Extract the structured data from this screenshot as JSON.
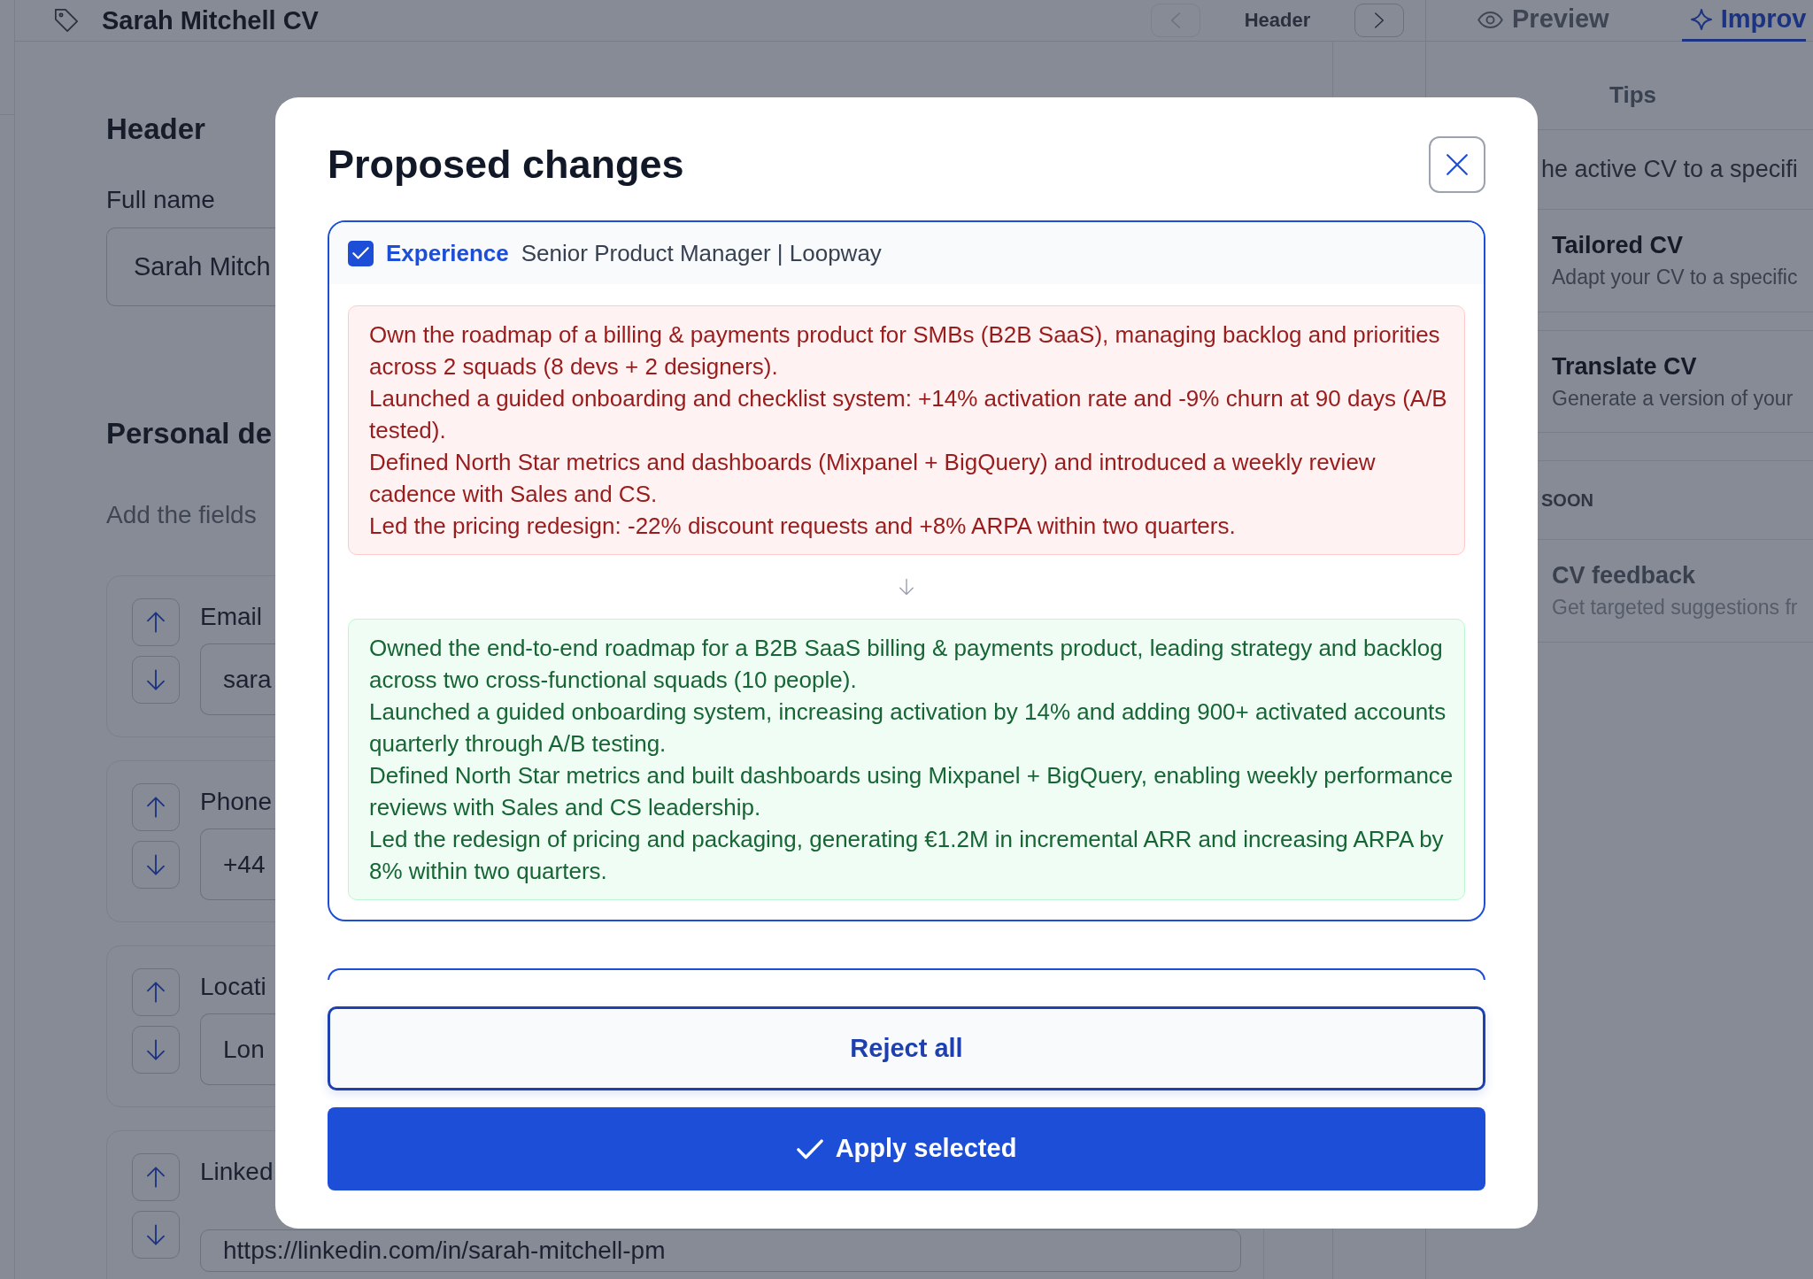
{
  "top_bar": {
    "title": "Sarah Mitchell CV",
    "section_nav": {
      "label": "Header",
      "prev": {
        "disabled": true
      },
      "next": {
        "disabled": false
      }
    }
  },
  "editor": {
    "header_section": {
      "title": "Header",
      "fields": [
        {
          "label": "Full name",
          "value": "Sarah Mitch"
        }
      ]
    },
    "personal_details": {
      "title": "Personal de",
      "hint": "Add the fields",
      "fields": [
        {
          "label": "Email",
          "value": "sara"
        },
        {
          "label": "Phone",
          "value": "+44"
        },
        {
          "label": "Locati",
          "value": "Lon"
        },
        {
          "label": "Linked",
          "value": "https://linkedin.com/in/sarah-mitchell-pm"
        }
      ]
    }
  },
  "side_panel": {
    "tabs": [
      {
        "label": "Preview",
        "selected": false
      },
      {
        "label": "Improv",
        "selected": true
      }
    ],
    "section_title": "Tips",
    "intro": "he active CV to a specifi",
    "tools": [
      {
        "title": "Tailored CV",
        "description": "Adapt your CV to a specific",
        "disabled": false
      },
      {
        "title": "Translate CV",
        "description": "Generate a version of your",
        "disabled": false
      }
    ],
    "soon_group": {
      "label": "SOON",
      "tools": [
        {
          "title": "CV feedback",
          "description": "Get targeted suggestions fr",
          "disabled": true
        }
      ]
    }
  },
  "dialog": {
    "title": "Proposed changes",
    "changes": [
      {
        "checked": true,
        "section": "Experience",
        "subtitle": "Senior Product Manager | Loopway",
        "before": [
          "Own the roadmap of a billing & payments product for SMBs (B2B SaaS), managing backlog and priorities across 2 squads (8 devs + 2 designers).",
          "Launched a guided onboarding and checklist system: +14% activation rate and -9% churn at 90 days (A/B tested).",
          "Defined North Star metrics and dashboards (Mixpanel + BigQuery) and introduced a weekly review cadence with Sales and CS.",
          "Led the pricing redesign: -22% discount requests and +8% ARPA within two quarters."
        ],
        "after": [
          "Owned the end-to-end roadmap for a B2B SaaS billing & payments product, leading strategy and backlog across two cross-functional squads (10 people).",
          "Launched a guided onboarding system, increasing activation by 14% and adding 900+ activated accounts quarterly through A/B testing.",
          "Defined North Star metrics and built dashboards using Mixpanel + BigQuery, enabling weekly performance reviews with Sales and CS leadership.",
          "Led the redesign of pricing and packaging, generating €1.2M in incremental ARR and increasing ARPA by 8% within two quarters."
        ]
      }
    ],
    "reject_button": "Reject all",
    "apply_button": "Apply selected"
  }
}
